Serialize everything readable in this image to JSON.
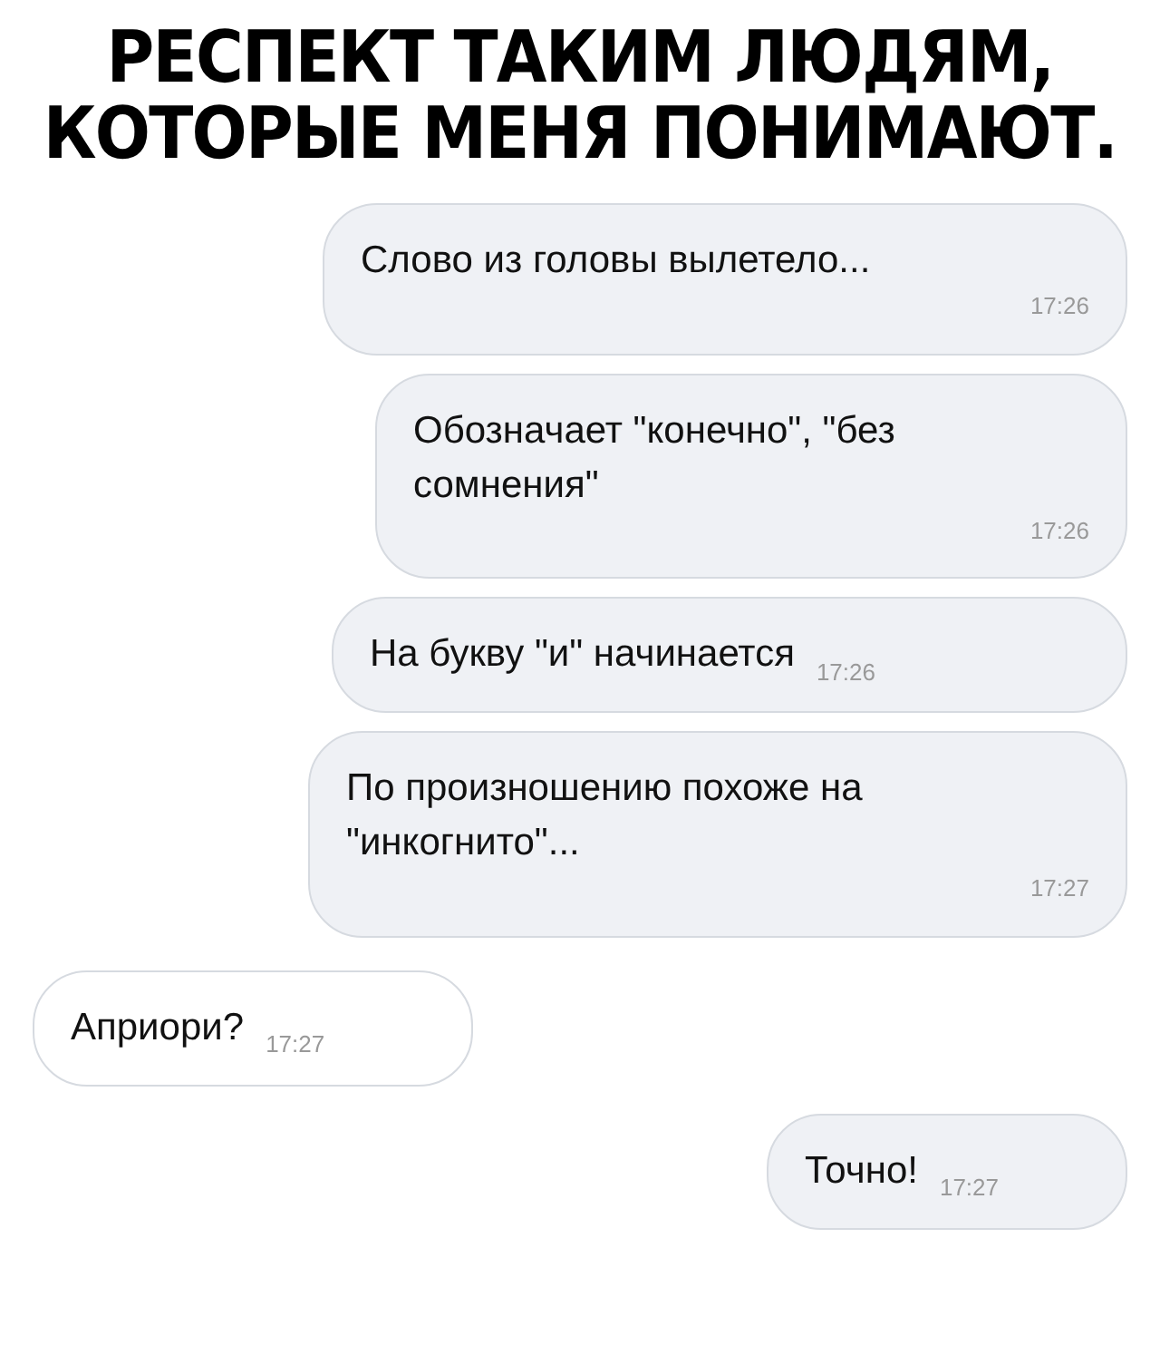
{
  "title_lines": [
    "РЕСПЕКТ ТАКИМ ЛЮДЯМ,",
    "КОТОРЫЕ МЕНЯ ПОНИМАЮТ."
  ],
  "messages": [
    {
      "kind": "outgoing",
      "text": "Слово из головы вылетело...",
      "time": "17:26"
    },
    {
      "kind": "outgoing",
      "text": "Обозначает \"конечно\", \"без сомнения\"",
      "time": "17:26"
    },
    {
      "kind": "outgoing",
      "text": "На букву \"и\" начинается",
      "time": "17:26"
    },
    {
      "kind": "outgoing",
      "text": "По произношению похоже на \"инкогнито\"...",
      "time": "17:27"
    },
    {
      "kind": "incoming",
      "text": "Априори?",
      "time": "17:27"
    },
    {
      "kind": "outgoing",
      "text": "Точно!",
      "time": "17:27"
    }
  ]
}
